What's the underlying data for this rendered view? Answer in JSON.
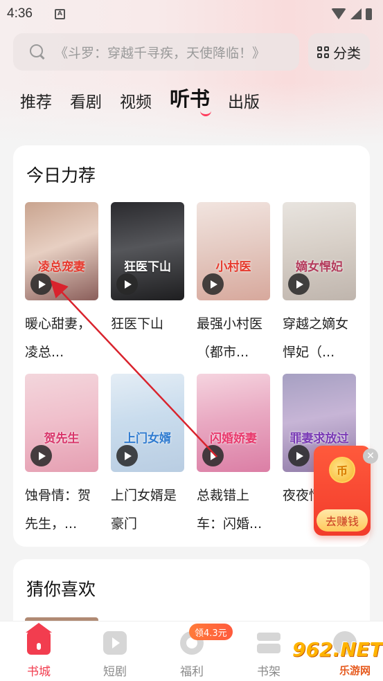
{
  "status": {
    "time": "4:36",
    "sim_label": "A"
  },
  "search": {
    "placeholder": "《斗罗：穿越千寻疾，天使降临！》"
  },
  "category_button": {
    "label": "分类"
  },
  "tabs": [
    {
      "label": "推荐",
      "active": false
    },
    {
      "label": "看剧",
      "active": false
    },
    {
      "label": "视频",
      "active": false
    },
    {
      "label": "听书",
      "active": true
    },
    {
      "label": "出版",
      "active": false
    }
  ],
  "today_picks": {
    "title": "今日力荐",
    "books": [
      {
        "title": "暖心甜妻，凌总...",
        "cover_text": "凌总宠妻",
        "icon": "play-icon"
      },
      {
        "title": "狂医下山",
        "cover_text": "狂医下山",
        "icon": "play-icon"
      },
      {
        "title": "最强小村医（都市...",
        "cover_text": "小村医",
        "icon": "play-icon"
      },
      {
        "title": "穿越之嫡女悍妃（...",
        "cover_text": "嫡女悍妃",
        "icon": "play-icon"
      },
      {
        "title": "蚀骨情：贺先生，...",
        "cover_text": "贺先生",
        "icon": "play-icon"
      },
      {
        "title": "上门女婿是豪门",
        "cover_text": "上门女婿",
        "icon": "play-icon"
      },
      {
        "title": "总裁错上车：闪婚...",
        "cover_text": "闪婚娇妻",
        "icon": "play-icon"
      },
      {
        "title": "夜夜情：...",
        "cover_text": "罪妻求放过",
        "icon": "play-icon"
      }
    ]
  },
  "earn": {
    "label": "去赚钱",
    "coin": "币"
  },
  "guess": {
    "title": "猜你喜欢"
  },
  "bottom_nav": [
    {
      "label": "书城",
      "icon": "home-icon",
      "active": true
    },
    {
      "label": "短剧",
      "icon": "video-icon",
      "active": false
    },
    {
      "label": "福利",
      "icon": "gift-icon",
      "active": false
    },
    {
      "label": "书架",
      "icon": "shelf-icon",
      "active": false
    },
    {
      "label": "",
      "icon": "profile-icon",
      "active": false
    }
  ],
  "welfare_badge": "领4.3元",
  "watermark": {
    "main": "962.NET",
    "sub": "乐游网"
  },
  "colors": {
    "accent": "#f23d4f",
    "earn": "#f23b2b",
    "annotation_arrow": "#d9232d"
  }
}
